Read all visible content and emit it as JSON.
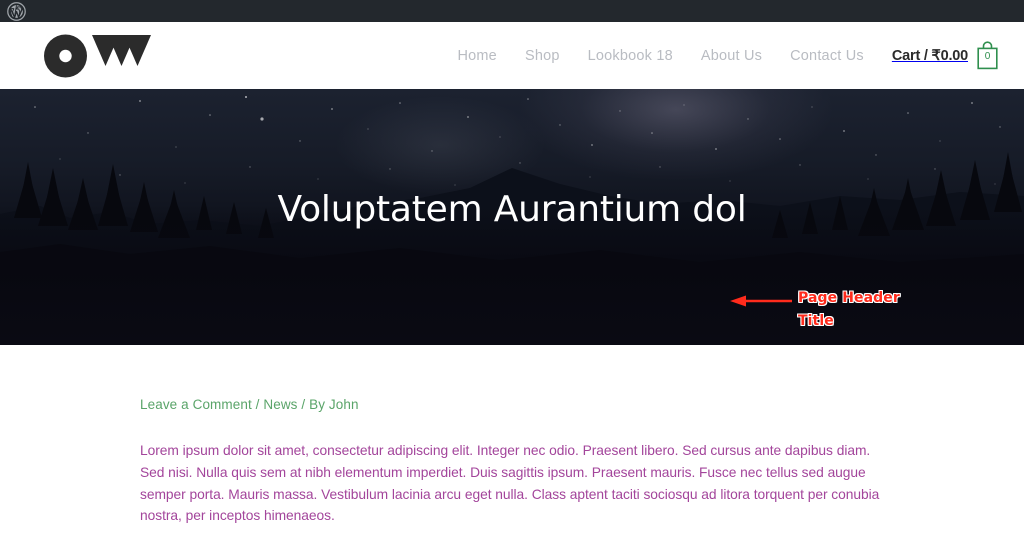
{
  "adminbar": {
    "wp_logo_icon": "wordpress-icon"
  },
  "header": {
    "logo_text": "OW",
    "logo_icon": "ow-logo-icon",
    "nav": [
      {
        "label": "Home"
      },
      {
        "label": "Shop"
      },
      {
        "label": "Lookbook 18"
      },
      {
        "label": "About Us"
      },
      {
        "label": "Contact Us"
      }
    ],
    "cart": {
      "label": "Cart / ₹0.00",
      "count": "0",
      "icon": "shopping-bag-icon",
      "accent_color": "#2f8f4e"
    }
  },
  "hero": {
    "title": "Voluptatem Aurantium dol",
    "background_description": "night-sky-mountains-photo",
    "annotation": {
      "line1": "Page Header",
      "line2": "Title",
      "color": "#ff2b1c",
      "arrow_icon": "left-arrow-icon"
    }
  },
  "post": {
    "meta": {
      "comments_link": "Leave a Comment",
      "sep1": " / ",
      "category": "News",
      "sep2": " / ",
      "author": "By John",
      "color": "#5aa469"
    },
    "body": "Lorem ipsum dolor sit amet, consectetur adipiscing elit. Integer nec odio. Praesent libero. Sed cursus ante dapibus diam. Sed nisi. Nulla quis sem at nibh elementum imperdiet. Duis sagittis ipsum. Praesent mauris. Fusce nec tellus sed augue semper porta. Mauris massa. Vestibulum lacinia arcu eget nulla. Class aptent taciti sociosqu ad litora torquent per conubia nostra, per inceptos himenaeos.",
    "body_color": "#a3459b"
  }
}
